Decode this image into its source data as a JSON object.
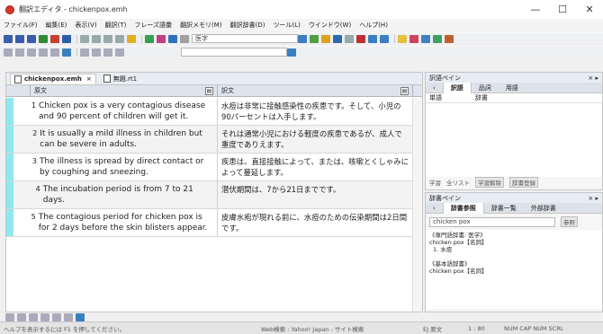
{
  "window": {
    "title": "翻訳エディタ - chickenpox.emh",
    "minimize": "—",
    "maximize": "☐",
    "close": "✕"
  },
  "menu": [
    "ファイル(F)",
    "編集(E)",
    "表示(V)",
    "翻訳(T)",
    "フレーズ語彙",
    "翻訳メモリ(M)",
    "翻訳辞書(D)",
    "ツール(L)",
    "ウインドウ(W)",
    "ヘルプ(H)"
  ],
  "toolbar": {
    "font_value": "医字",
    "search_placeholder": ""
  },
  "tabs": [
    {
      "label": "chickenpox.emh",
      "active": true,
      "close": "×"
    },
    {
      "label": "無題.rt1",
      "active": false,
      "close": ""
    }
  ],
  "grid": {
    "header_src": "原文",
    "header_tgt": "訳文",
    "rows": [
      {
        "num": "1",
        "src": "Chicken pox is a very contagious disease and 90 percent of children will get it.",
        "tgt": "水痘は非常に接触感染性の疾患です。そして、小児の90パーセントは入手します。"
      },
      {
        "num": "2",
        "src": "It is usually a mild illness in children but can be severe in adults.",
        "tgt": "それは通常小児における軽度の疾患であるが、成人で重度でありえます。"
      },
      {
        "num": "3",
        "src": "The illness is spread by direct contact or by coughing and sneezing.",
        "tgt": "疾患は、直接接触によって、または、咳嗽とくしゃみによって蔓延します。"
      },
      {
        "num": "4",
        "src": "The incubation period is from 7 to 21 days.",
        "tgt": "潜伏期間は、7から21日までです。"
      },
      {
        "num": "5",
        "src": "The contagious period for chicken pox is for 2 days before the skin blisters appear.",
        "tgt": "皮膚水疱が現れる前に、水痘のための伝染期間は2日間です。"
      }
    ]
  },
  "pane1": {
    "title": "訳語ペイン",
    "tabs": [
      "訳語",
      "品詞",
      "用語"
    ],
    "col1": "単語",
    "col2": "辞書",
    "buttons": [
      "学習",
      "全リスト",
      "学習解除",
      "辞書登録"
    ]
  },
  "pane2": {
    "title": "辞書ペイン",
    "tabs": [
      "辞書参照",
      "辞書一覧",
      "外部辞書"
    ],
    "query": "chicken pox",
    "ref_button": "参照",
    "entries": [
      "《専門語辞書: 医学》",
      "chicken pox【名詞】",
      "1. 水痘",
      "",
      "《基本語辞書》",
      "chicken pox【名詞】"
    ]
  },
  "status": {
    "help": "ヘルプを表示するには F1 を押してください。",
    "web": "Web検索 : Yahoo! Japan - サイト検索",
    "lang": "EJ 原文",
    "pos": "1 : 80",
    "flags": "NUM  CAP  NUM  SCRL"
  },
  "colors": {
    "gutter": "#8ee8ec",
    "accent": "#d43a2a"
  }
}
